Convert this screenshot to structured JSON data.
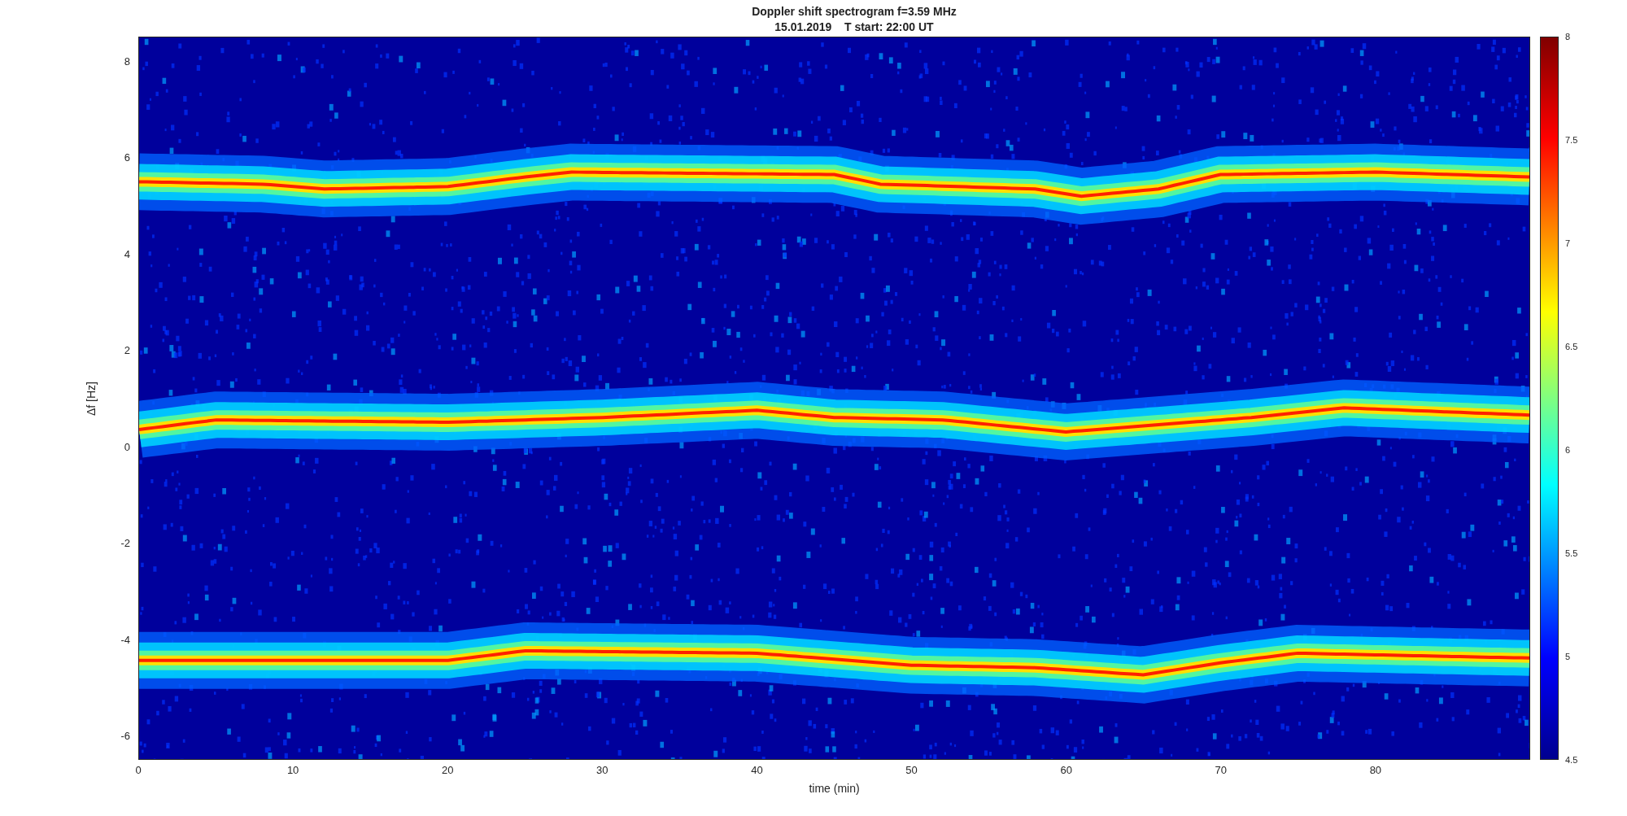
{
  "figure": {
    "title_lines": [
      "Doppler shift spectrogram f=3.59 MHz",
      "15.01.2019    T start: 22:00 UT"
    ],
    "ylabel": "Δf [Hz]",
    "xlabel": "time (min)",
    "yticks": [
      "8",
      "6",
      "4",
      "2",
      "0",
      "-2",
      "-4",
      "-6"
    ],
    "xticks": [
      "0",
      "10",
      "20",
      "30",
      "40",
      "50",
      "60",
      "70",
      "80"
    ],
    "colorbar_ticks": [
      "8",
      "7.5",
      "7",
      "6.5",
      "6",
      "5.5",
      "5",
      "4.5"
    ]
  }
}
